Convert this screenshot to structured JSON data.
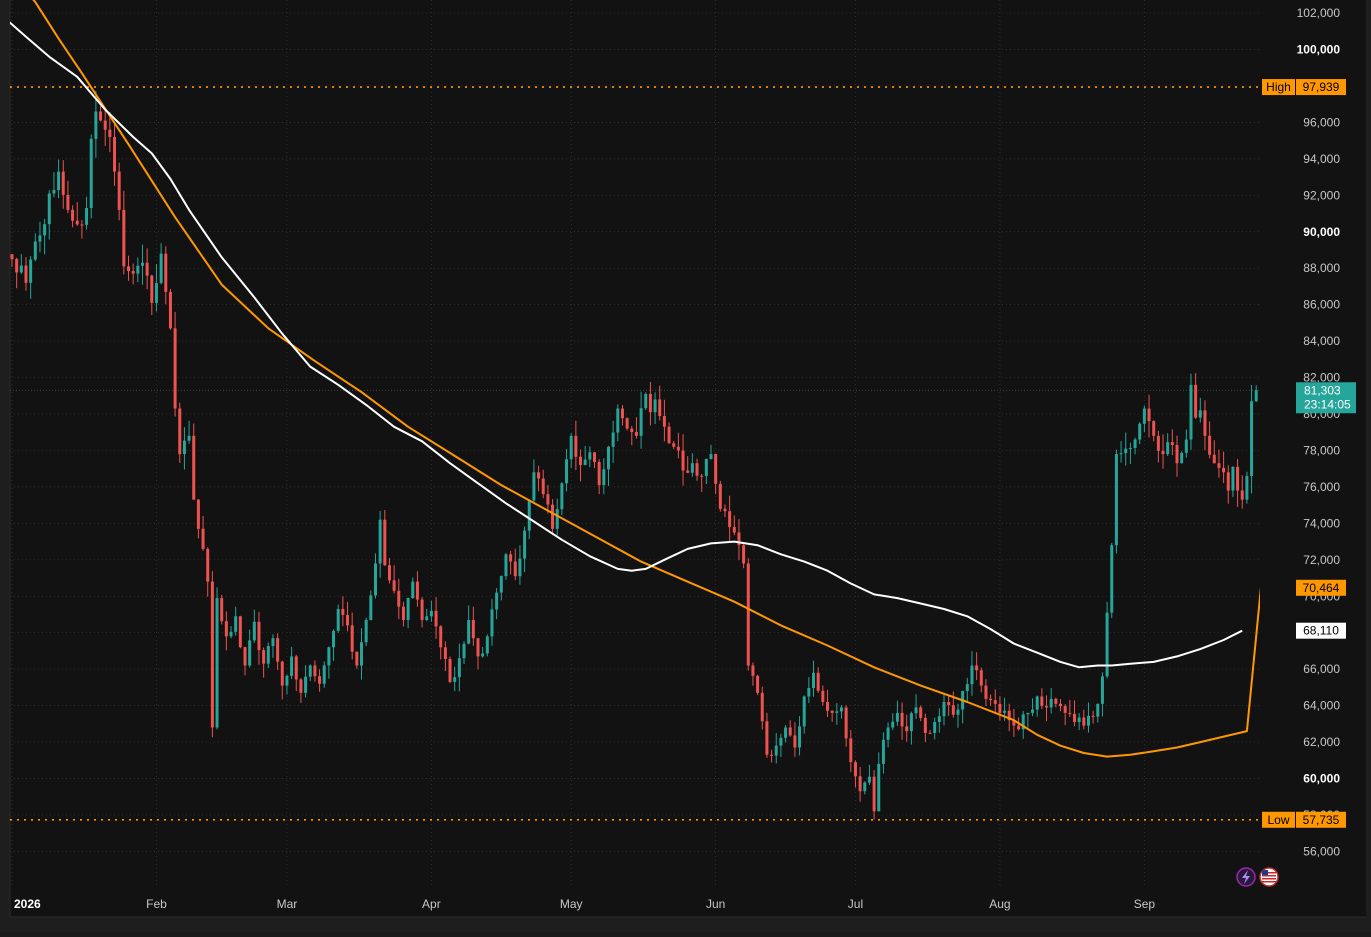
{
  "chart_data": {
    "type": "candlestick",
    "colors": {
      "background": "#121212",
      "frame": "#2a2a2a",
      "grid": "#3a3a3a",
      "axis_text": "#c8c8c8",
      "up": "#26a69a",
      "down": "#ef5350",
      "ma_slow": "#ff9800",
      "ma_fast": "#ffffff",
      "high_low": "#ff9800"
    },
    "y_axis": {
      "ticks": [
        56000,
        58000,
        60000,
        62000,
        64000,
        66000,
        68000,
        70000,
        72000,
        74000,
        76000,
        78000,
        80000,
        82000,
        84000,
        86000,
        88000,
        90000,
        92000,
        94000,
        96000,
        98000,
        100000,
        102000
      ],
      "tick_labels": [
        "56,000",
        "58,000",
        "60,000",
        "62,000",
        "64,000",
        "66,000",
        "68,000",
        "70,000",
        "72,000",
        "74,000",
        "76,000",
        "78,000",
        "80,000",
        "82,000",
        "84,000",
        "86,000",
        "88,000",
        "90,000",
        "92,000",
        "94,000",
        "96,000",
        "98,000",
        "100,000",
        "102,000"
      ],
      "bold_ticks": [
        60000,
        90000,
        100000
      ]
    },
    "x_axis": {
      "labels": [
        {
          "day": 0,
          "text": "2026",
          "bold": true
        },
        {
          "day": 31,
          "text": "Feb",
          "bold": false
        },
        {
          "day": 59,
          "text": "Mar",
          "bold": false
        },
        {
          "day": 90,
          "text": "Apr",
          "bold": false
        },
        {
          "day": 120,
          "text": "May",
          "bold": false
        },
        {
          "day": 151,
          "text": "Jun",
          "bold": false
        },
        {
          "day": 181,
          "text": "Jul",
          "bold": false
        },
        {
          "day": 212,
          "text": "Aug",
          "bold": false
        },
        {
          "day": 243,
          "text": "Sep",
          "bold": false
        }
      ]
    },
    "high": {
      "label": "High",
      "value": 97939,
      "display": "97,939"
    },
    "low": {
      "label": "Low",
      "value": 57735,
      "display": "57,735"
    },
    "last": {
      "value": 81303,
      "display": "81,303",
      "countdown": "23:14:05"
    },
    "ma_slow_tag": {
      "value": 70464,
      "display": "70,464"
    },
    "ma_fast_tag": {
      "value": 68110,
      "display": "68,110"
    },
    "close_path": [
      [
        0,
        88500
      ],
      [
        3,
        87200
      ],
      [
        6,
        89800
      ],
      [
        8,
        92100
      ],
      [
        10,
        93300
      ],
      [
        12,
        91200
      ],
      [
        14,
        90400
      ],
      [
        16,
        91300
      ],
      [
        17,
        95100
      ],
      [
        18,
        96600
      ],
      [
        19,
        96100
      ],
      [
        20,
        95600
      ],
      [
        21,
        95200
      ],
      [
        22,
        93300
      ],
      [
        23,
        91200
      ],
      [
        24,
        88100
      ],
      [
        26,
        87700
      ],
      [
        28,
        88300
      ],
      [
        30,
        86100
      ],
      [
        32,
        88800
      ],
      [
        33,
        86700
      ],
      [
        34,
        84700
      ],
      [
        35,
        80300
      ],
      [
        36,
        77800
      ],
      [
        38,
        78800
      ],
      [
        39,
        75300
      ],
      [
        40,
        73700
      ],
      [
        41,
        72600
      ],
      [
        42,
        70800
      ],
      [
        43,
        62800
      ],
      [
        44,
        69900
      ],
      [
        46,
        67800
      ],
      [
        48,
        68900
      ],
      [
        50,
        66200
      ],
      [
        52,
        68600
      ],
      [
        54,
        66300
      ],
      [
        56,
        67700
      ],
      [
        58,
        65100
      ],
      [
        60,
        66700
      ],
      [
        62,
        64700
      ],
      [
        64,
        66200
      ],
      [
        66,
        65200
      ],
      [
        68,
        67200
      ],
      [
        70,
        69300
      ],
      [
        72,
        68400
      ],
      [
        74,
        66200
      ],
      [
        76,
        68700
      ],
      [
        78,
        71800
      ],
      [
        79,
        74200
      ],
      [
        80,
        71700
      ],
      [
        82,
        70300
      ],
      [
        84,
        68700
      ],
      [
        86,
        70800
      ],
      [
        88,
        68700
      ],
      [
        90,
        69200
      ],
      [
        92,
        67200
      ],
      [
        94,
        65300
      ],
      [
        96,
        66600
      ],
      [
        98,
        68700
      ],
      [
        100,
        66700
      ],
      [
        102,
        67800
      ],
      [
        104,
        70200
      ],
      [
        106,
        72300
      ],
      [
        108,
        71100
      ],
      [
        110,
        73600
      ],
      [
        112,
        76800
      ],
      [
        114,
        75600
      ],
      [
        116,
        73700
      ],
      [
        118,
        76200
      ],
      [
        120,
        78800
      ],
      [
        122,
        77200
      ],
      [
        124,
        77900
      ],
      [
        126,
        76100
      ],
      [
        128,
        78200
      ],
      [
        130,
        80300
      ],
      [
        132,
        79200
      ],
      [
        134,
        78800
      ],
      [
        136,
        81100
      ],
      [
        137,
        80100
      ],
      [
        138,
        80800
      ],
      [
        140,
        79300
      ],
      [
        142,
        78200
      ],
      [
        144,
        76900
      ],
      [
        146,
        77300
      ],
      [
        148,
        76600
      ],
      [
        150,
        77800
      ],
      [
        152,
        74800
      ],
      [
        154,
        73800
      ],
      [
        156,
        72800
      ],
      [
        157,
        71800
      ],
      [
        158,
        66200
      ],
      [
        160,
        64700
      ],
      [
        162,
        61300
      ],
      [
        164,
        61800
      ],
      [
        166,
        62800
      ],
      [
        168,
        61700
      ],
      [
        170,
        64500
      ],
      [
        172,
        65800
      ],
      [
        174,
        64200
      ],
      [
        176,
        63600
      ],
      [
        178,
        63900
      ],
      [
        179,
        62200
      ],
      [
        180,
        60900
      ],
      [
        182,
        59300
      ],
      [
        184,
        60100
      ],
      [
        185,
        58200
      ],
      [
        186,
        60800
      ],
      [
        188,
        62800
      ],
      [
        190,
        63600
      ],
      [
        192,
        62600
      ],
      [
        194,
        63900
      ],
      [
        196,
        62500
      ],
      [
        198,
        63100
      ],
      [
        200,
        64200
      ],
      [
        202,
        63500
      ],
      [
        204,
        64800
      ],
      [
        206,
        66200
      ],
      [
        208,
        65100
      ],
      [
        210,
        64300
      ],
      [
        212,
        63600
      ],
      [
        214,
        63200
      ],
      [
        216,
        62700
      ],
      [
        218,
        63600
      ],
      [
        220,
        64500
      ],
      [
        222,
        63900
      ],
      [
        224,
        64100
      ],
      [
        226,
        63600
      ],
      [
        228,
        63100
      ],
      [
        230,
        62900
      ],
      [
        232,
        63400
      ],
      [
        233,
        64100
      ],
      [
        234,
        65600
      ],
      [
        235,
        69100
      ],
      [
        236,
        72800
      ],
      [
        237,
        77800
      ],
      [
        239,
        78100
      ],
      [
        241,
        78600
      ],
      [
        243,
        80300
      ],
      [
        245,
        78800
      ],
      [
        247,
        77800
      ],
      [
        249,
        78300
      ],
      [
        250,
        77300
      ],
      [
        252,
        78600
      ],
      [
        253,
        81600
      ],
      [
        254,
        79800
      ],
      [
        255,
        80200
      ],
      [
        256,
        78800
      ],
      [
        258,
        77300
      ],
      [
        260,
        76800
      ],
      [
        261,
        75800
      ],
      [
        262,
        77100
      ],
      [
        263,
        75800
      ],
      [
        264,
        75300
      ],
      [
        265,
        76600
      ],
      [
        266,
        80700
      ],
      [
        267,
        81303
      ]
    ],
    "ma_slow": [
      [
        -1,
        104400
      ],
      [
        5,
        102600
      ],
      [
        10,
        100600
      ],
      [
        15,
        98700
      ],
      [
        25,
        94800
      ],
      [
        35,
        90800
      ],
      [
        45,
        87100
      ],
      [
        55,
        84700
      ],
      [
        65,
        82900
      ],
      [
        75,
        81200
      ],
      [
        85,
        79300
      ],
      [
        95,
        77700
      ],
      [
        105,
        76100
      ],
      [
        115,
        74700
      ],
      [
        125,
        73300
      ],
      [
        135,
        71900
      ],
      [
        145,
        70800
      ],
      [
        155,
        69700
      ],
      [
        165,
        68400
      ],
      [
        175,
        67300
      ],
      [
        185,
        66100
      ],
      [
        195,
        65100
      ],
      [
        205,
        64200
      ],
      [
        215,
        63200
      ],
      [
        220,
        62400
      ],
      [
        225,
        61800
      ],
      [
        230,
        61400
      ],
      [
        235,
        61200
      ],
      [
        240,
        61300
      ],
      [
        245,
        61500
      ],
      [
        250,
        61700
      ],
      [
        255,
        62000
      ],
      [
        260,
        62300
      ],
      [
        265,
        62600
      ],
      [
        268,
        70464
      ]
    ],
    "ma_fast": [
      [
        -1,
        101600
      ],
      [
        3,
        100700
      ],
      [
        8,
        99600
      ],
      [
        14,
        98500
      ],
      [
        20,
        96700
      ],
      [
        26,
        95200
      ],
      [
        30,
        94300
      ],
      [
        34,
        92900
      ],
      [
        38,
        91200
      ],
      [
        45,
        88600
      ],
      [
        52,
        86400
      ],
      [
        58,
        84400
      ],
      [
        64,
        82600
      ],
      [
        70,
        81600
      ],
      [
        76,
        80500
      ],
      [
        82,
        79300
      ],
      [
        88,
        78500
      ],
      [
        94,
        77300
      ],
      [
        100,
        76200
      ],
      [
        106,
        75100
      ],
      [
        112,
        74100
      ],
      [
        118,
        73100
      ],
      [
        124,
        72200
      ],
      [
        130,
        71500
      ],
      [
        133,
        71400
      ],
      [
        136,
        71500
      ],
      [
        140,
        72000
      ],
      [
        145,
        72600
      ],
      [
        150,
        72900
      ],
      [
        155,
        73000
      ],
      [
        160,
        72800
      ],
      [
        165,
        72300
      ],
      [
        170,
        71900
      ],
      [
        175,
        71400
      ],
      [
        180,
        70700
      ],
      [
        185,
        70100
      ],
      [
        190,
        69900
      ],
      [
        195,
        69600
      ],
      [
        200,
        69300
      ],
      [
        205,
        68900
      ],
      [
        210,
        68200
      ],
      [
        215,
        67400
      ],
      [
        220,
        66900
      ],
      [
        225,
        66400
      ],
      [
        229,
        66100
      ],
      [
        233,
        66200
      ],
      [
        236,
        66200
      ],
      [
        240,
        66300
      ],
      [
        245,
        66400
      ],
      [
        250,
        66700
      ],
      [
        255,
        67100
      ],
      [
        260,
        67600
      ],
      [
        264,
        68110
      ]
    ],
    "icons": [
      "bolt-icon",
      "us-flag-icon"
    ]
  }
}
